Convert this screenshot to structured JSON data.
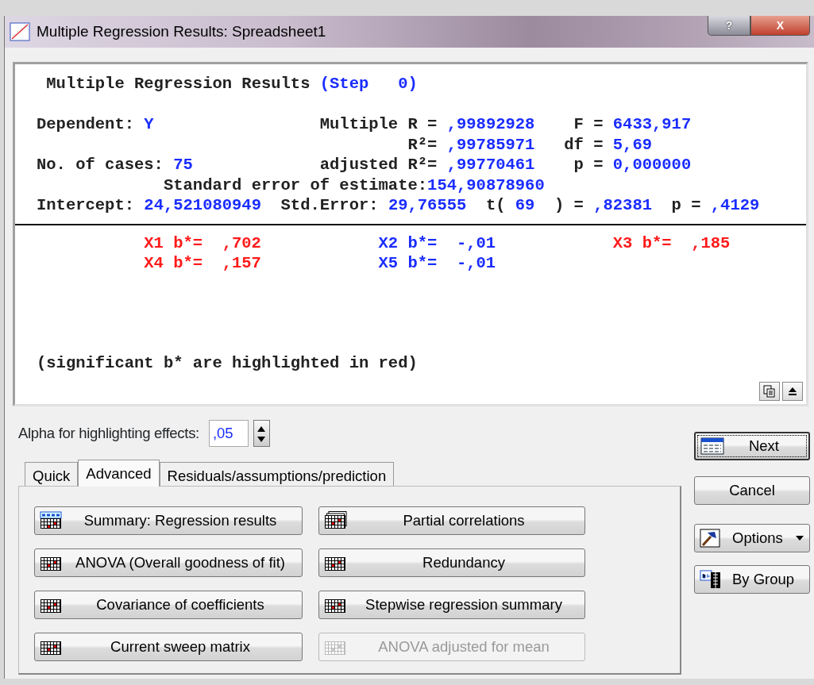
{
  "window": {
    "title": "Multiple Regression Results: Spreadsheet1",
    "caption_buttons": [
      "?",
      "X"
    ]
  },
  "report": {
    "title": "Multiple Regression Results",
    "step": "(Step   0)",
    "stats": [
      {
        "left_label": "Dependent:",
        "left_value": "Y",
        "mid_label": "Multiple R =",
        "mid_value": ",99892928",
        "right_label": "F =",
        "right_value": "6433,917"
      },
      {
        "mid_label": "R²=",
        "mid_value": ",99785971",
        "right_label": "df =",
        "right_value": "5,69"
      },
      {
        "left_label": "No. of cases:",
        "left_value": "75",
        "mid_label": "adjusted R²=",
        "mid_value": ",99770461",
        "right_label": "p =",
        "right_value": "0,000000"
      }
    ],
    "std_error": {
      "label": "Standard error of estimate:",
      "value": "154,90878960"
    },
    "intercept": [
      {
        "label": "Intercept:",
        "value": "24,521080949"
      },
      {
        "label": "Std.Error:",
        "value": "29,76555"
      },
      {
        "label": "t(",
        "value": "69"
      },
      {
        "label": ") =",
        "value": ",82381"
      },
      {
        "label": "p =",
        "value": ",4129"
      }
    ],
    "coefficients": [
      {
        "label": "X1 b*=",
        "value": ",702",
        "significant": true
      },
      {
        "label": "X2 b*=",
        "value": "-,01",
        "significant": false
      },
      {
        "label": "X3 b*=",
        "value": ",185",
        "significant": true
      },
      {
        "label": "X4 b*=",
        "value": ",157",
        "significant": true
      },
      {
        "label": "X5 b*=",
        "value": "-,01",
        "significant": false
      }
    ],
    "note": "(significant b* are highlighted in red)"
  },
  "alpha": {
    "label": "Alpha for highlighting effects:",
    "value": ",05"
  },
  "tabs": [
    {
      "label": "Quick",
      "selected": false
    },
    {
      "label": "Advanced",
      "selected": true
    },
    {
      "label": "Residuals/assumptions/prediction",
      "selected": false
    }
  ],
  "buttons": [
    {
      "label": "Summary:  Regression results",
      "disabled": false
    },
    {
      "label": "Partial correlations",
      "disabled": false
    },
    {
      "label": "ANOVA (Overall goodness of fit)",
      "disabled": false
    },
    {
      "label": "Redundancy",
      "disabled": false
    },
    {
      "label": "Covariance of coefficients",
      "disabled": false
    },
    {
      "label": "Stepwise regression summary",
      "disabled": false
    },
    {
      "label": "Current sweep matrix",
      "disabled": false
    },
    {
      "label": "ANOVA adjusted for mean",
      "disabled": true
    }
  ],
  "side_buttons": [
    {
      "label": "Next",
      "default": true
    },
    {
      "label": "Cancel",
      "default": false
    },
    {
      "label": "Options",
      "default": false
    },
    {
      "label": "By Group",
      "default": false
    }
  ]
}
